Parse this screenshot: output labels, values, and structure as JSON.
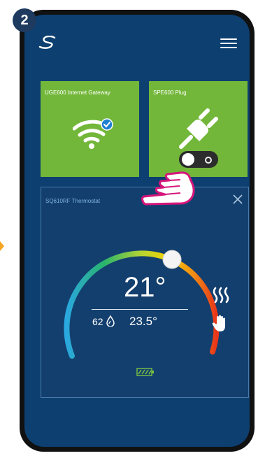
{
  "step_number": "2",
  "app": {
    "logo_icon": "salus-swirl-icon",
    "menu_icon": "hamburger-menu-icon"
  },
  "tiles": [
    {
      "label": "UGE600 Internet Gateway",
      "icon": "wifi-check-icon",
      "color": "#73b73a"
    },
    {
      "label": "SPE600 Plug",
      "icon": "plug-icon",
      "color": "#73b73a",
      "toggle_on": true
    }
  ],
  "thermostat": {
    "title": "SQ610RF Thermostat",
    "setpoint": "21°",
    "humidity": "62",
    "floor_temp": "23.5°",
    "heating_icon": "heating-waves-icon",
    "mode_icon": "manual-hand-icon",
    "battery_icon": "battery-full-icon",
    "close_icon": "close-icon"
  },
  "overlay": {
    "pointer_icon": "hand-pointer-icon"
  },
  "colors": {
    "screen_bg": "#0d3f70",
    "tile_green": "#73b73a",
    "card_bg": "#133f6e",
    "accent_pink": "#d6157a",
    "badge": "#1e3a5f"
  }
}
